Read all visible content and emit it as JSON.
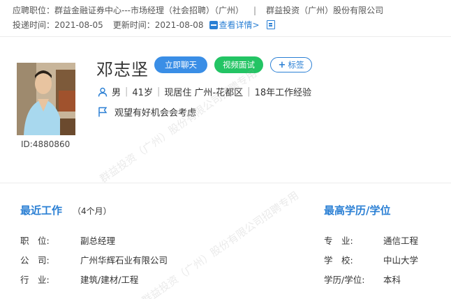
{
  "header": {
    "apply_label": "应聘职位：",
    "apply_position": "群益金融证券中心---市场经理（社会招聘）（广州）",
    "separator": "|",
    "company": "群益投资（广州）股份有限公司",
    "deliver_label": "投递时间：",
    "deliver_date": "2021-08-05",
    "update_label": "更新时间：",
    "update_date": "2021-08-08",
    "detail_link": "查看详情>"
  },
  "profile": {
    "name": "邓志坚",
    "chat_button": "立即聊天",
    "video_button": "视频面试",
    "tag_plus": "+",
    "tag_button": "标签",
    "gender": "男",
    "age": "41岁",
    "residence": "现居住 广州-花都区",
    "experience": "18年工作经验",
    "intent": "观望有好机会会考虑",
    "id": "ID:4880860"
  },
  "watermark": "群益投资（广州）股份有限公司招聘专用",
  "recent_work": {
    "title": "最近工作",
    "duration": "（4个月）",
    "rows": [
      {
        "label": "职　位:",
        "value": "副总经理"
      },
      {
        "label": "公　司:",
        "value": "广州华辉石业有限公司"
      },
      {
        "label": "行　业:",
        "value": "建筑/建材/工程"
      }
    ]
  },
  "education": {
    "title": "最高学历/学位",
    "rows": [
      {
        "label": "专　业:",
        "value": "通信工程"
      },
      {
        "label": "学　校:",
        "value": "中山大学"
      },
      {
        "label": "学历/学位:",
        "value": "本科"
      }
    ]
  },
  "colors": {
    "accent_blue": "#3a8ee6",
    "accent_green": "#23c464",
    "link_blue": "#2a7fd4"
  }
}
